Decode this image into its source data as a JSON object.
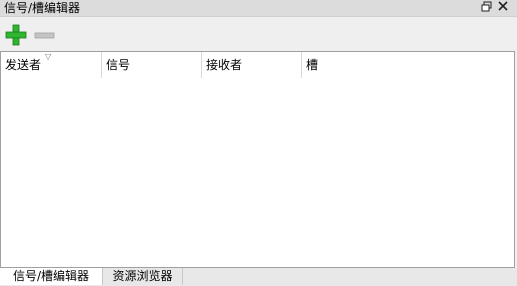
{
  "window": {
    "title": "信号/槽编辑器",
    "float_icon": "float-window-icon",
    "close_icon": "close-icon"
  },
  "toolbar": {
    "add_icon": "plus-icon",
    "remove_icon": "minus-icon"
  },
  "table": {
    "columns": [
      "发送者",
      "信号",
      "接收者",
      "槽"
    ],
    "rows": []
  },
  "tabs": [
    {
      "label": "信号/槽编辑器",
      "active": true
    },
    {
      "label": "资源浏览器",
      "active": false
    }
  ],
  "colors": {
    "add_green": "#2fb52f",
    "remove_gray": "#b8b8b8"
  }
}
